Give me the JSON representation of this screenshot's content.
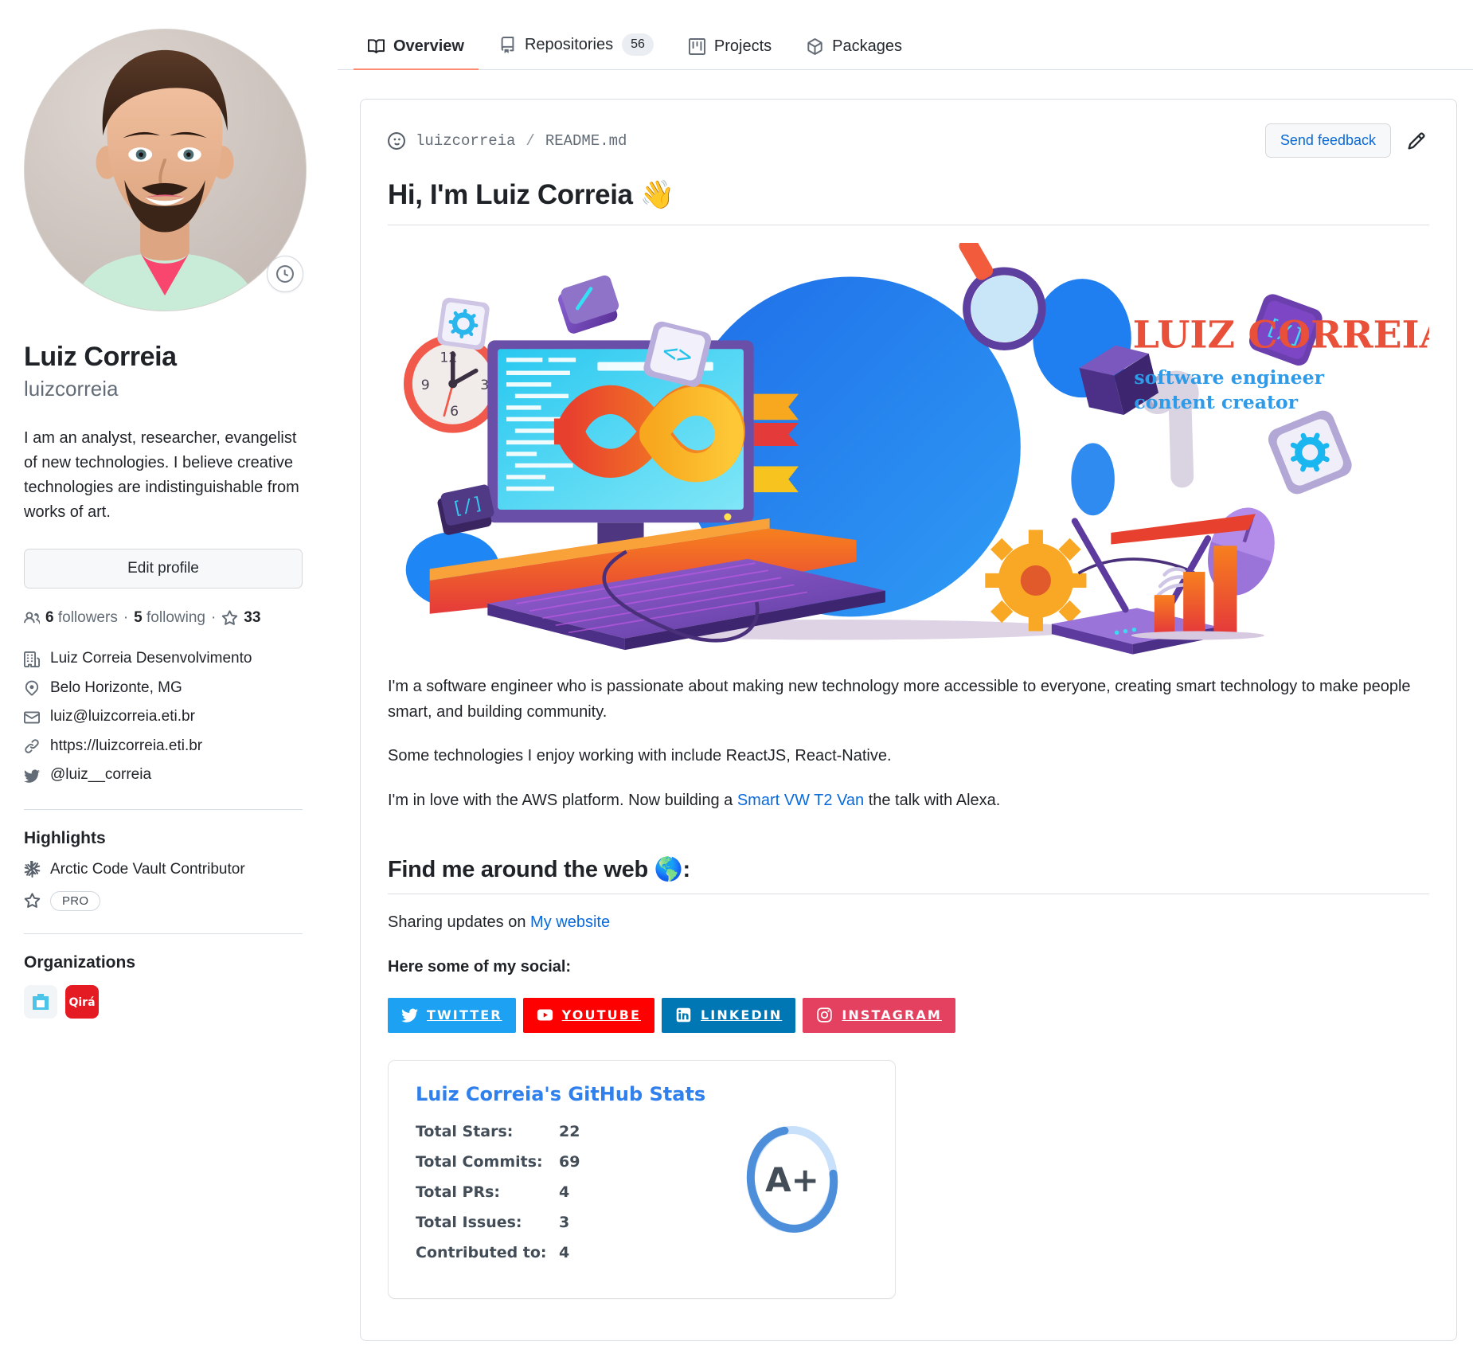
{
  "nav": {
    "items": [
      {
        "label": "Overview",
        "icon": "book-icon",
        "active": true,
        "count": null
      },
      {
        "label": "Repositories",
        "icon": "repo-icon",
        "active": false,
        "count": "56"
      },
      {
        "label": "Projects",
        "icon": "project-icon",
        "active": false,
        "count": null
      },
      {
        "label": "Packages",
        "icon": "package-icon",
        "active": false,
        "count": null
      }
    ]
  },
  "profile": {
    "name": "Luiz Correia",
    "login": "luizcorreia",
    "bio": "I am an analyst, researcher, evangelist of new technologies. I believe creative technologies are indistinguishable from works of art.",
    "edit_label": "Edit profile",
    "followers_count": "6",
    "followers_label": "followers",
    "following_count": "5",
    "following_label": "following",
    "stars_count": "33",
    "separator": "·",
    "meta": [
      {
        "icon": "organization-icon",
        "text": "Luiz Correia Desenvolvimento"
      },
      {
        "icon": "location-icon",
        "text": "Belo Horizonte, MG"
      },
      {
        "icon": "mail-icon",
        "text": "luiz@luizcorreia.eti.br"
      },
      {
        "icon": "link-icon",
        "text": "https://luizcorreia.eti.br"
      },
      {
        "icon": "twitter-icon",
        "text": "@luiz__correia"
      }
    ],
    "highlights_title": "Highlights",
    "highlights": [
      {
        "icon": "arctic-vault-icon",
        "text": "Arctic Code Vault Contributor",
        "pill": null
      },
      {
        "icon": "star-icon",
        "text": "",
        "pill": "PRO"
      }
    ],
    "organizations_title": "Organizations",
    "organizations": [
      {
        "name": "org-logo-blue",
        "color": "#4BC4E8"
      },
      {
        "name": "org-logo-qira",
        "color": "#E51B23",
        "text": "Qirá"
      }
    ]
  },
  "readme": {
    "owner": "luizcorreia",
    "slash": "/",
    "file": "README.md",
    "feedback_label": "Send feedback",
    "heading": "Hi, I'm Luiz Correia 👋",
    "banner": {
      "title": "LUIZ CORREIA",
      "subtitle_1": "software engineer",
      "subtitle_2": "content creator",
      "title_color": "#E8503A",
      "subtitle_color": "#2F9BE8"
    },
    "paragraph_1": "I'm a software engineer who is passionate about making new technology more accessible to everyone, creating smart technology to make people smart, and building community.",
    "paragraph_2": "Some technologies I enjoy working with include ReactJS, React-Native.",
    "paragraph_3_before": "I'm in love with the AWS platform. Now building a ",
    "paragraph_3_link": "Smart VW T2 Van",
    "paragraph_3_after": " the talk with Alexa.",
    "section_heading": "Find me around the web 🌎:",
    "sharing_before": "Sharing updates on ",
    "sharing_link": "My website",
    "social_intro": "Here some of my social:",
    "socials": [
      {
        "label": "TWITTER",
        "icon": "twitter-icon",
        "color": "#1DA1F2"
      },
      {
        "label": "YOUTUBE",
        "icon": "youtube-icon",
        "color": "#FF0000"
      },
      {
        "label": "LINKEDIN",
        "icon": "linkedin-icon",
        "color": "#0077B5"
      },
      {
        "label": "INSTAGRAM",
        "icon": "instagram-icon",
        "color": "#E4405F"
      }
    ],
    "stats": {
      "title": "Luiz Correia's GitHub Stats",
      "title_color": "#2F80ED",
      "rows": [
        {
          "label": "Total Stars:",
          "value": "22"
        },
        {
          "label": "Total Commits:",
          "value": "69"
        },
        {
          "label": "Total PRs:",
          "value": "4"
        },
        {
          "label": "Total Issues:",
          "value": "3"
        },
        {
          "label": "Contributed to:",
          "value": "4"
        }
      ],
      "rank": "A+",
      "rank_color": "#4C8EDA",
      "rank_track_color": "#C9E0FB"
    }
  }
}
